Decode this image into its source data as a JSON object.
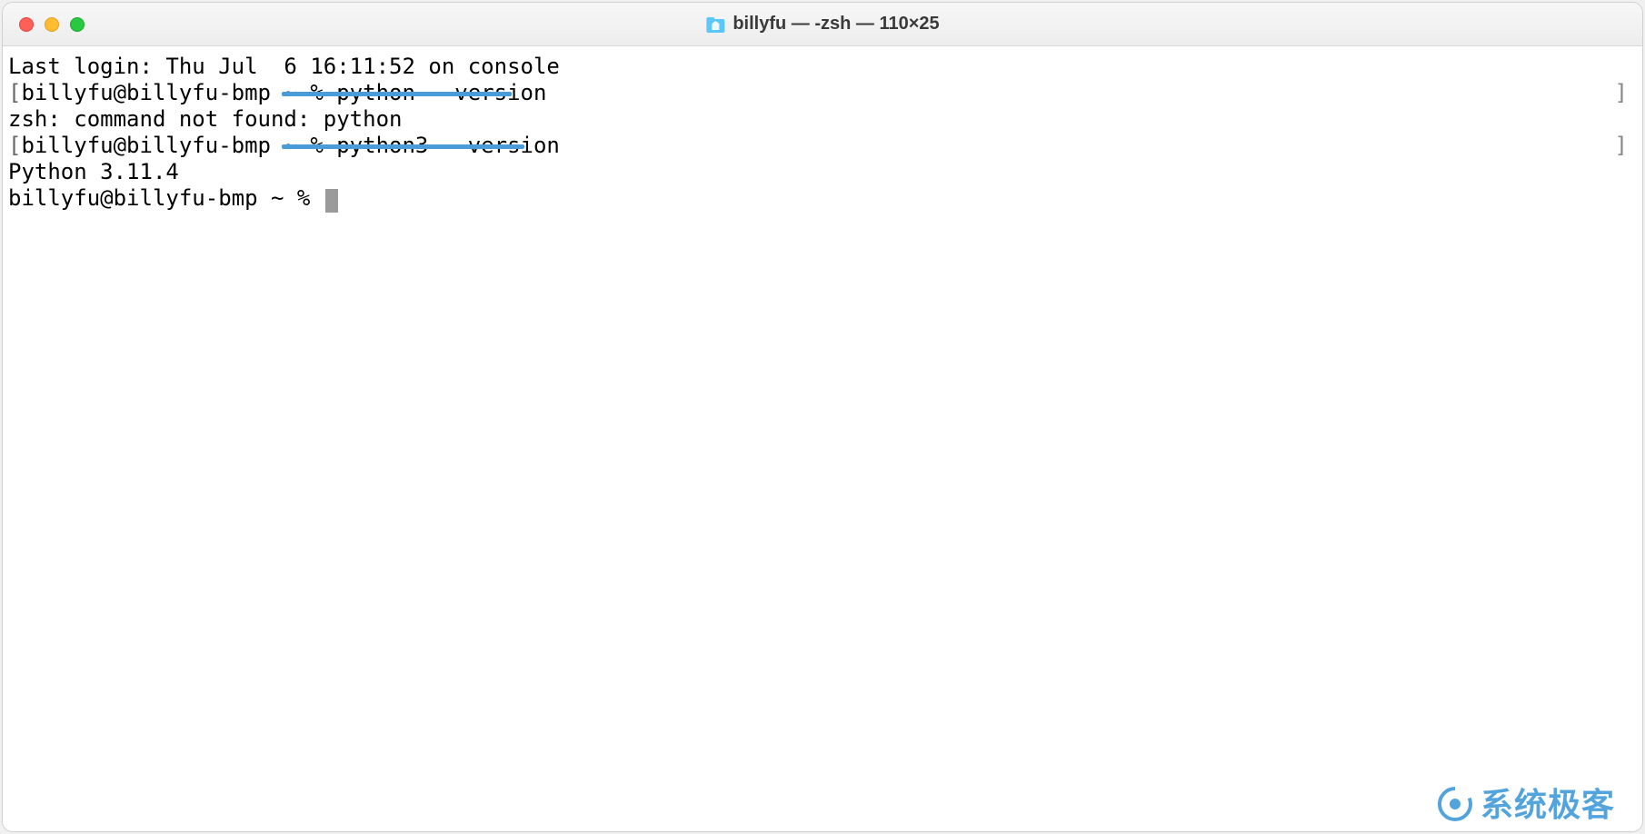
{
  "window": {
    "title": "billyfu — -zsh — 110×25"
  },
  "terminal": {
    "lines": [
      "Last login: Thu Jul  6 16:11:52 on console",
      "billyfu@billyfu-bmp ~ % python --version",
      "zsh: command not found: python",
      "billyfu@billyfu-bmp ~ % python3 --version",
      "Python 3.11.4"
    ],
    "current_prompt": "billyfu@billyfu-bmp ~ % ",
    "bracket_left": "[",
    "bracket_right": "]"
  },
  "watermark": {
    "text": "系统极客"
  }
}
